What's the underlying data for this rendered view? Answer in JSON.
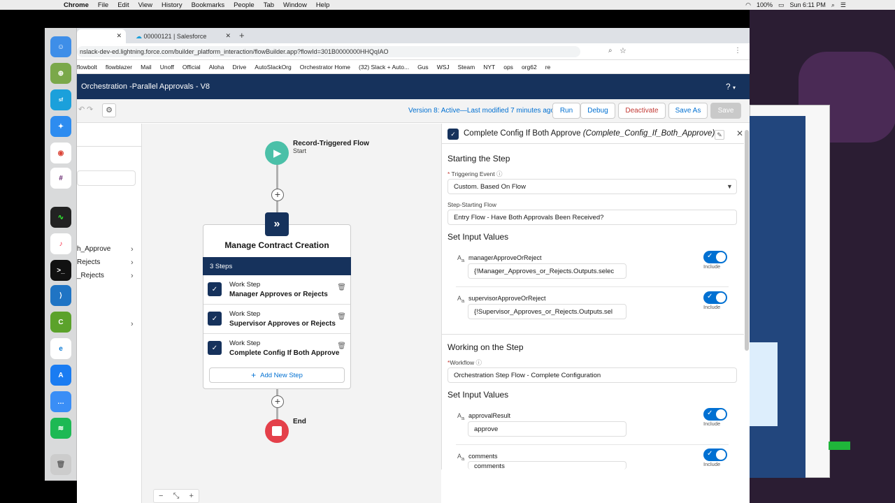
{
  "mac_menu": {
    "app": "Chrome",
    "items": [
      "File",
      "Edit",
      "View",
      "History",
      "Bookmarks",
      "People",
      "Tab",
      "Window",
      "Help"
    ],
    "battery": "100%",
    "clock": "Sun 6:11 PM"
  },
  "browser": {
    "tabs": [
      "",
      "00000121 | Salesforce"
    ],
    "url": "nslack-dev-ed.lightning.force.com/builder_platform_interaction/flowBuilder.app?flowId=301B0000000HHQqIAO",
    "bookmarks": [
      "flowbolt",
      "flowblazer",
      "Mail",
      "Unoff",
      "Official",
      "Aloha",
      "Drive",
      "AutoSlackOrg",
      "Orchestrator Home",
      "(32) Slack + Auto...",
      "Gus",
      "WSJ",
      "Steam",
      "NYT",
      "ops",
      "org62",
      "re"
    ]
  },
  "header": {
    "title": "Orchestration -Parallel Approvals - V8",
    "help": "?"
  },
  "toolbar": {
    "version_text": "Version 8: Active—Last modified 7 minutes ago",
    "run": "Run",
    "debug": "Debug",
    "deactivate": "Deactivate",
    "save_as": "Save As",
    "save": "Save"
  },
  "left_panel": {
    "items": [
      "h_Approve",
      "Rejects",
      "_Rejects"
    ]
  },
  "canvas": {
    "start_title": "Record-Triggered Flow",
    "start_sub": "Start",
    "stage_title": "Manage Contract Creation",
    "steps_count": "3 Steps",
    "steps": [
      {
        "type": "Work Step",
        "name": "Manager Approves or Rejects"
      },
      {
        "type": "Work Step",
        "name": "Supervisor Approves or Rejects"
      },
      {
        "type": "Work Step",
        "name": "Complete Config If Both Approve"
      }
    ],
    "add_step": "Add New Step",
    "end_label": "End"
  },
  "panel": {
    "title": "Complete Config If Both Approve",
    "api_name": "(Complete_Config_If_Both_Approve)",
    "section_start": "Starting the Step",
    "triggering_event_label": "Triggering Event",
    "triggering_event_value": "Custom. Based On Flow",
    "starting_flow_label": "Step-Starting Flow",
    "starting_flow_value": "Entry Flow - Have Both Approvals Been Received?",
    "set_inputs_1": "Set Input Values",
    "inputs_1": [
      {
        "name": "managerApproveOrReject",
        "value": "{!Manager_Approves_or_Rejects.Outputs.selec",
        "include": "Include"
      },
      {
        "name": "supervisorApproveOrReject",
        "value": "{!Supervisor_Approves_or_Rejects.Outputs.sel",
        "include": "Include"
      }
    ],
    "section_work": "Working on the Step",
    "workflow_label": "Workflow",
    "workflow_value": "Orchestration Step Flow - Complete Configuration",
    "set_inputs_2": "Set Input Values",
    "inputs_2": [
      {
        "name": "approvalResult",
        "value": "approve",
        "include": "Include"
      },
      {
        "name": "comments",
        "value": "comments",
        "include": "Include"
      }
    ]
  },
  "colors": {
    "header_bg": "#16325c",
    "brand_blue": "#0070d2",
    "start_green": "#4bc0a8",
    "end_red": "#e4404a",
    "deactivate_red": "#c23934"
  }
}
